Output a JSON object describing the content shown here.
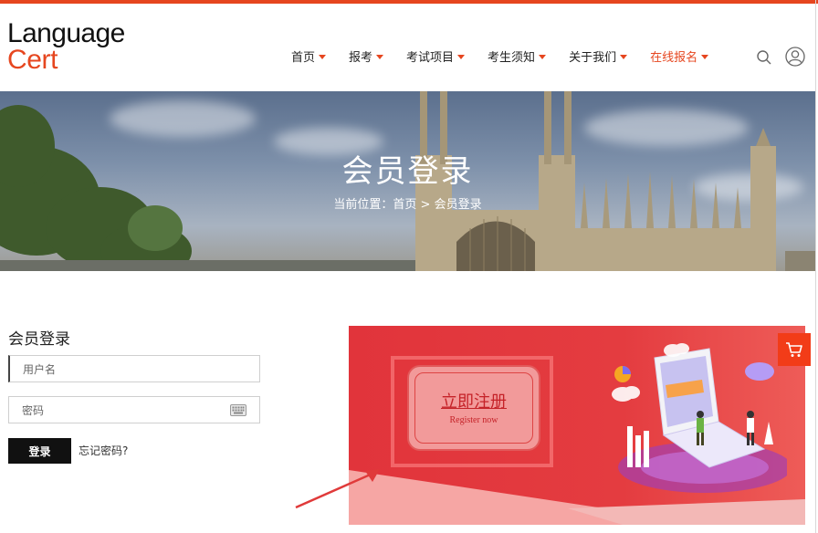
{
  "brand": {
    "line1": "Language",
    "line2": "Cert",
    "accent": "#e6461f"
  },
  "nav": [
    {
      "label": "首页",
      "active": false
    },
    {
      "label": "报考",
      "active": false
    },
    {
      "label": "考试项目",
      "active": false
    },
    {
      "label": "考生须知",
      "active": false
    },
    {
      "label": "关于我们",
      "active": false
    },
    {
      "label": "在线报名",
      "active": true
    }
  ],
  "header_icons": {
    "search": "search-icon",
    "user": "user-icon"
  },
  "banner": {
    "title": "会员登录",
    "breadcrumb_prefix": "当前位置：",
    "breadcrumb_home": "首页",
    "breadcrumb_sep": ">",
    "breadcrumb_current": "会员登录"
  },
  "login": {
    "title": "会员登录",
    "username_placeholder": "用户名",
    "password_placeholder": "密码",
    "submit_label": "登录",
    "forgot_label": "忘记密码?"
  },
  "register": {
    "title": "立即注册",
    "subtitle": "Register now",
    "bg_color": "#e1343b"
  },
  "floating": {
    "cart_icon": "cart-icon",
    "cart_color": "#f23c18"
  }
}
